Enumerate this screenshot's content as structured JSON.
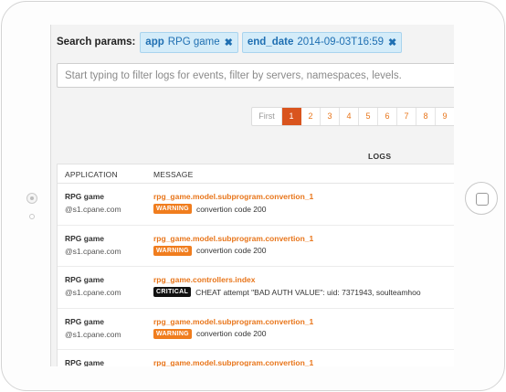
{
  "search": {
    "label": "Search params:",
    "tags": [
      {
        "key": "app",
        "value": "RPG game",
        "remove_icon": "times-icon"
      },
      {
        "key": "end_date",
        "value": "2014-09-03T16:59",
        "remove_icon": "times-icon"
      }
    ],
    "filter_placeholder": "Start typing to filter logs for events, filter by servers, namespaces, levels.",
    "filter_value": ""
  },
  "pagination": {
    "first_label": "First",
    "pages": [
      "1",
      "2",
      "3",
      "4",
      "5",
      "6",
      "7",
      "8",
      "9"
    ],
    "active_page": "1"
  },
  "logs": {
    "title": "LOGS",
    "columns": {
      "application": "APPLICATION",
      "message": "MESSAGE"
    },
    "rows": [
      {
        "app": "RPG game",
        "host": "@s1.cpane.com",
        "source": "rpg_game.model.subprogram.convertion_1",
        "level": "WARNING",
        "level_color": "#f07d1e",
        "message": "convertion code 200"
      },
      {
        "app": "RPG game",
        "host": "@s1.cpane.com",
        "source": "rpg_game.model.subprogram.convertion_1",
        "level": "WARNING",
        "level_color": "#f07d1e",
        "message": "convertion code 200"
      },
      {
        "app": "RPG game",
        "host": "@s1.cpane.com",
        "source": "rpg_game.controllers.index",
        "level": "CRITICAL",
        "level_color": "#111111",
        "message": "CHEAT attempt \"BAD AUTH VALUE\": uid: 7371943, soulteamhoo"
      },
      {
        "app": "RPG game",
        "host": "@s1.cpane.com",
        "source": "rpg_game.model.subprogram.convertion_1",
        "level": "WARNING",
        "level_color": "#f07d1e",
        "message": "convertion code 200"
      },
      {
        "app": "RPG game",
        "host": "",
        "source": "rpg_game.model.subprogram.convertion_1",
        "level": "",
        "level_color": "",
        "message": ""
      }
    ]
  },
  "colors": {
    "accent": "#e8751a",
    "active_page_bg": "#d9541e",
    "tag_bg": "#d4ecf9",
    "tag_text": "#1f6fb2"
  }
}
